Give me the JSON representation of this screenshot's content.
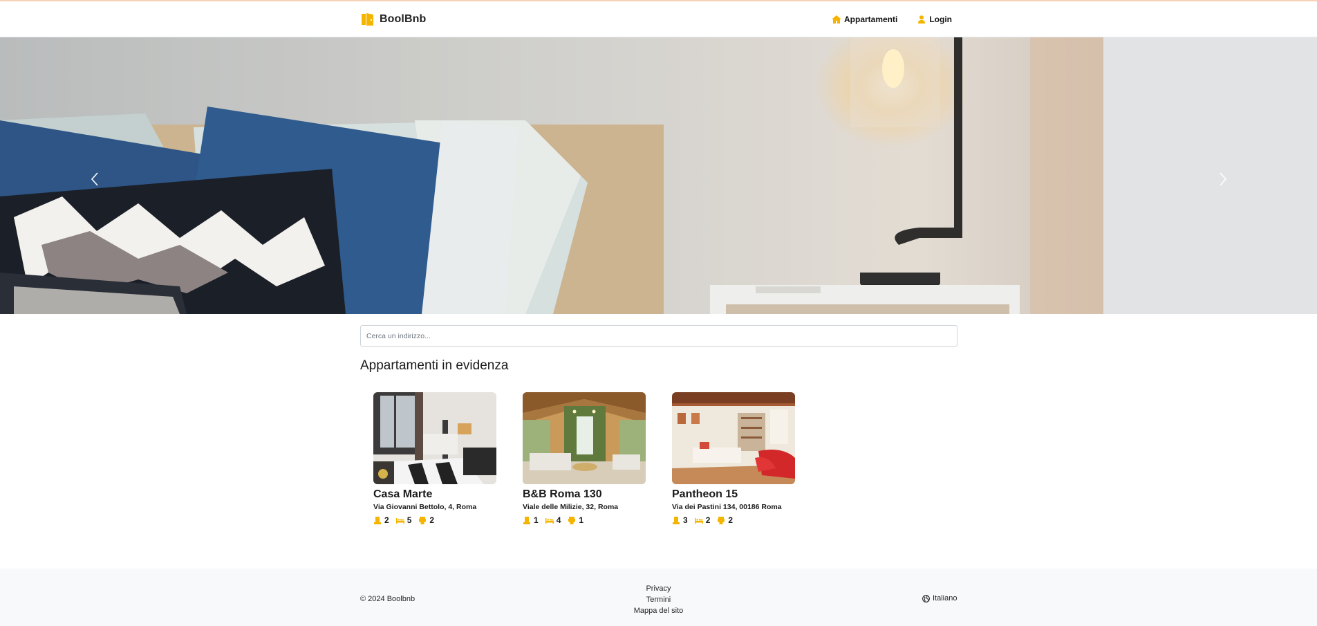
{
  "navbar": {
    "brand": "BoolBnb",
    "links": [
      {
        "label": "Appartamenti",
        "icon": "house-icon"
      },
      {
        "label": "Login",
        "icon": "user-icon"
      }
    ]
  },
  "hero": {
    "image": "bedroom with pillows and bedside lamp",
    "prev_icon": "chevron-left-icon",
    "next_icon": "chevron-right-icon"
  },
  "search": {
    "placeholder": "Cerca un indirizzo..."
  },
  "featured": {
    "title": "Appartamenti in evidenza",
    "apartments": [
      {
        "name": "Casa Marte",
        "address": "Via Giovanni Bettolo, 4, Roma",
        "rooms": "2",
        "beds": "5",
        "bathrooms": "2"
      },
      {
        "name": "B&B Roma 130",
        "address": "Viale delle Milizie, 32, Roma",
        "rooms": "1",
        "beds": "4",
        "bathrooms": "1"
      },
      {
        "name": "Pantheon 15",
        "address": "Via dei Pastini 134, 00186 Roma",
        "rooms": "3",
        "beds": "2",
        "bathrooms": "2"
      }
    ]
  },
  "footer": {
    "copyright": "© 2024 Boolbnb",
    "links": [
      "Privacy",
      "Termini",
      "Mappa del sito"
    ],
    "language": "Italiano"
  },
  "colors": {
    "accent": "#f5b400",
    "footer_bg": "#f8f9fa"
  }
}
